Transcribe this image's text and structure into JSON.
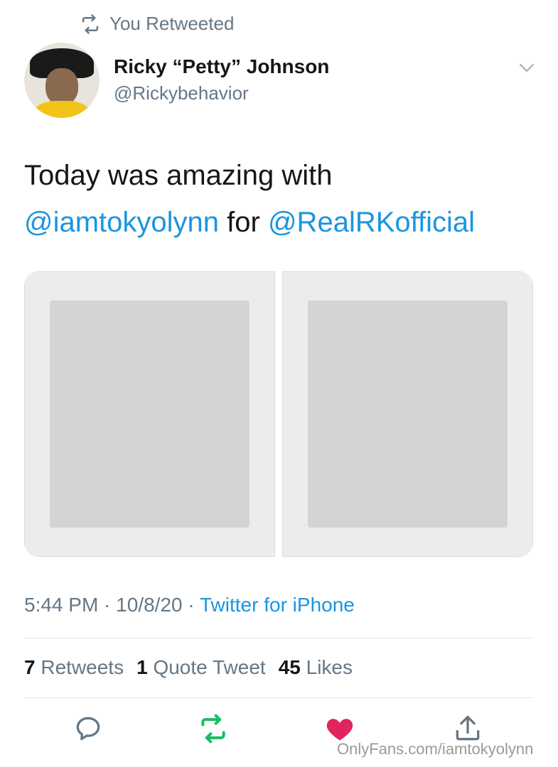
{
  "retweet_banner": {
    "icon": "retweet-icon",
    "label": "You Retweeted"
  },
  "author": {
    "name": "Ricky “Petty” Johnson",
    "handle": "@Rickybehavior",
    "avatar": "avatar"
  },
  "tweet": {
    "line1": "Today was amazing with",
    "mention1": "@iamtokyolynn",
    "connector": " for ",
    "mention2": "@RealRKofficial"
  },
  "media": {
    "count": 2
  },
  "meta": {
    "time": "5:44 PM",
    "sep1": " · ",
    "date": "10/8/20",
    "sep2": " · ",
    "source": "Twitter for iPhone"
  },
  "stats": {
    "retweets_count": "7",
    "retweets_label": "Retweets",
    "quotes_count": "1",
    "quotes_label": "Quote Tweet",
    "likes_count": "45",
    "likes_label": "Likes"
  },
  "actions": {
    "reply": "reply-icon",
    "retweet": "retweet-icon",
    "like": "heart-icon",
    "share": "share-icon"
  },
  "colors": {
    "accent": "#1b95e0",
    "retweet_active": "#17bf63",
    "like_active": "#e0245e",
    "muted": "#657786"
  },
  "watermark": "OnlyFans.com/iamtokyolynn"
}
